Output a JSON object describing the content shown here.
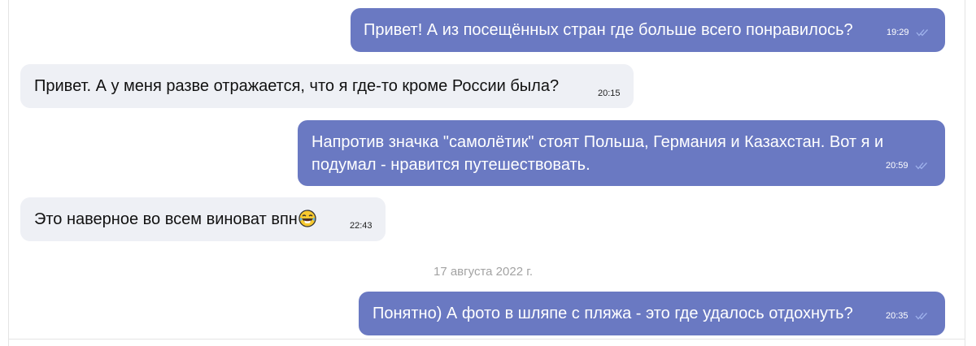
{
  "chat": {
    "messages": [
      {
        "direction": "out",
        "text": "Привет! А из посещённых стран где больше всего понравилось?",
        "time": "19:29",
        "status_icon": "double-check-icon"
      },
      {
        "direction": "in",
        "text": "Привет. А у меня разве отражается, что я где-то кроме России была?",
        "time": "20:15"
      },
      {
        "direction": "out",
        "text": "Напротив значка \"самолётик\" стоят Польша, Германия и Казахстан. Вот я и подумал - нравится путешествовать.",
        "time": "20:59",
        "status_icon": "double-check-icon"
      },
      {
        "direction": "in",
        "text": "Это наверное во всем виноват впн",
        "emoji": "laughing-tears-emoji-icon",
        "time": "22:43"
      },
      {
        "direction": "out",
        "text": "Понятно) А фото в шляпе с пляжа - это где удалось отдохнуть?",
        "time": "20:35",
        "status_icon": "double-check-icon"
      }
    ],
    "date_separator": "17 августа 2022 г."
  },
  "colors": {
    "outgoing_bubble": "#6a79c2",
    "incoming_bubble": "#eef0f5",
    "read_check": "#9fb2ec",
    "date_text": "#a3a3a3"
  }
}
